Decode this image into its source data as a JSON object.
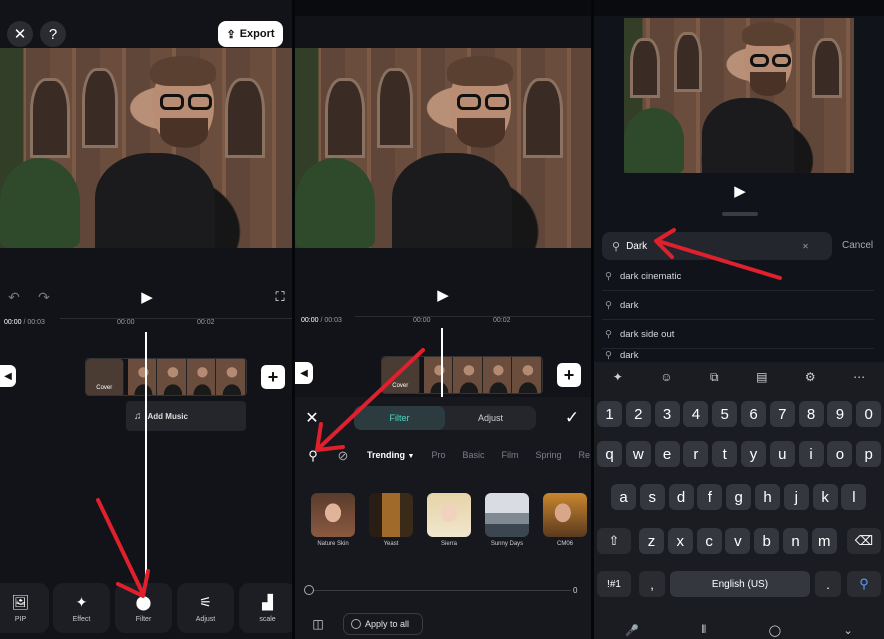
{
  "panel1": {
    "close_icon": "close-icon",
    "help_label": "?",
    "export_label": "Export",
    "timecode_current": "00:00",
    "timecode_total": "/ 00:03",
    "ruler_marks": [
      "00:00",
      "00:02"
    ],
    "cover_label": "Cover",
    "add_music_label": "Add Music",
    "toolbar": [
      {
        "label": "PIP",
        "icon": "image-icon"
      },
      {
        "label": "Effect",
        "icon": "sparkle-icon"
      },
      {
        "label": "Filter",
        "icon": "filter-icon"
      },
      {
        "label": "Adjust",
        "icon": "sliders-icon"
      },
      {
        "label": "scale",
        "icon": "scale-icon"
      }
    ]
  },
  "panel2": {
    "timecode_current": "00:00",
    "timecode_total": "/ 00:03",
    "ruler_marks": [
      "00:00",
      "00:02"
    ],
    "cover_label": "Cover",
    "tab_filter": "Filter",
    "tab_adjust": "Adjust",
    "categories": [
      "Trending",
      "Pro",
      "Basic",
      "Film",
      "Spring",
      "Re"
    ],
    "filters": [
      "Nature Skin",
      "Yeast",
      "Sierra",
      "Sunny Days",
      "CM06"
    ],
    "slider_value": "0",
    "apply_all_label": "Apply to all"
  },
  "panel3": {
    "search_value": "Dark",
    "cancel_label": "Cancel",
    "suggestions": [
      "dark cinematic",
      "dark",
      "dark side out",
      "dark"
    ],
    "keyboard": {
      "row_numbers": [
        "1",
        "2",
        "3",
        "4",
        "5",
        "6",
        "7",
        "8",
        "9",
        "0"
      ],
      "row1": [
        "q",
        "w",
        "e",
        "r",
        "t",
        "y",
        "u",
        "i",
        "o",
        "p"
      ],
      "row2": [
        "a",
        "s",
        "d",
        "f",
        "g",
        "h",
        "j",
        "k",
        "l"
      ],
      "row3": [
        "z",
        "x",
        "c",
        "v",
        "b",
        "n",
        "m"
      ],
      "sym_key": "!#1",
      "comma_key": ",",
      "space_label": "English (US)",
      "period_key": "."
    }
  },
  "colors": {
    "accent_teal": "#4fd8c6",
    "arrow_red": "#e0202c"
  }
}
